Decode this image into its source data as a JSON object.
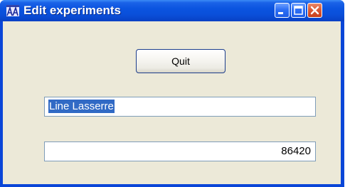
{
  "window": {
    "title": "Edit experiments",
    "app_icon": "app-logo-icon",
    "controls": [
      "minimize-icon",
      "maximize-icon",
      "close-icon"
    ]
  },
  "buttons": {
    "quit_label": "Quit"
  },
  "fields": {
    "name_value": "Line Lasserre",
    "name_selected": true,
    "number_value": "86420"
  },
  "colors": {
    "titlebar": "#0a4fd9",
    "client_background": "#ece9d8",
    "selection": "#316ac5",
    "close_button": "#dc5a35"
  }
}
